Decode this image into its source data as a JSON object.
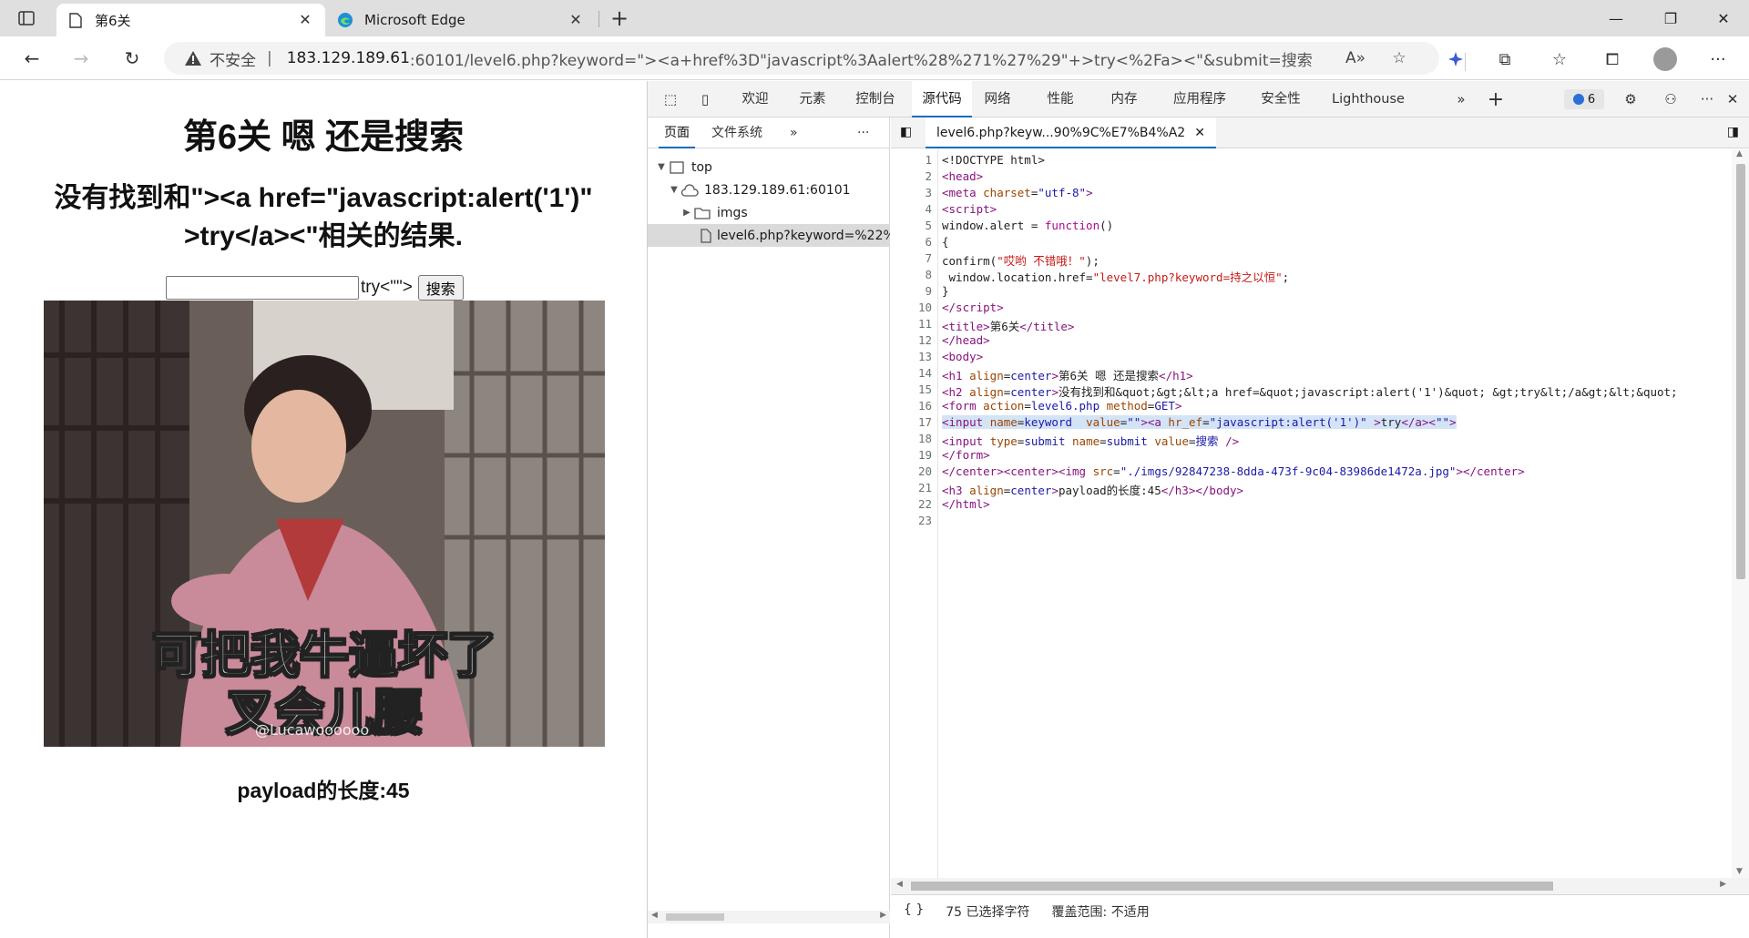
{
  "browser": {
    "tabs": [
      {
        "title": "第6关",
        "active": true
      },
      {
        "title": "Microsoft Edge",
        "active": false
      }
    ],
    "address": {
      "insecure_label": "不安全",
      "separator": "|",
      "host": "183.129.189.61",
      "path": ":60101/level6.php?keyword=\"><a+href%3D\"javascript%3Aalert%28%271%27%29\"+>try<%2Fa><\"&submit=搜索"
    }
  },
  "page": {
    "h1": "第6关 嗯 还是搜索",
    "h2_line1": "没有找到和\"><a href=\"javascript:alert('1')\"",
    "h2_line2": ">try</a><\"相关的结果.",
    "input_value": "",
    "input_trailing_text": "try<\"\">",
    "search_button": "搜索",
    "meme_caption_line1": "可把我牛逼坏了",
    "meme_caption_line2": "叉会儿腰",
    "meme_watermark": "@Lucawoooooo",
    "h3": "payload的长度:45"
  },
  "devtools": {
    "tabs": [
      "欢迎",
      "元素",
      "控制台",
      "源代码",
      "网络",
      "性能",
      "内存",
      "应用程序",
      "安全性",
      "Lighthouse"
    ],
    "active_tab": "源代码",
    "issues_count": "6",
    "navigator": {
      "tabs": [
        "页面",
        "文件系统"
      ],
      "tree": [
        "top",
        "183.129.189.61:60101",
        "imgs",
        "level6.php?keyword=%22%"
      ]
    },
    "editor": {
      "open_file": "level6.php?keyw...90%9C%E7%B4%A2",
      "line_numbers": [
        "1",
        "2",
        "3",
        "4",
        "5",
        "6",
        "7",
        "8",
        "9",
        "10",
        "11",
        "12",
        "13",
        "14",
        "15",
        "16",
        "17",
        "18",
        "19",
        "20",
        "21",
        "22",
        "23"
      ],
      "highlighted_line": 17
    },
    "status": {
      "braces": "{ }",
      "selected": "75 已选择字符",
      "coverage": "覆盖范围: 不适用"
    }
  }
}
